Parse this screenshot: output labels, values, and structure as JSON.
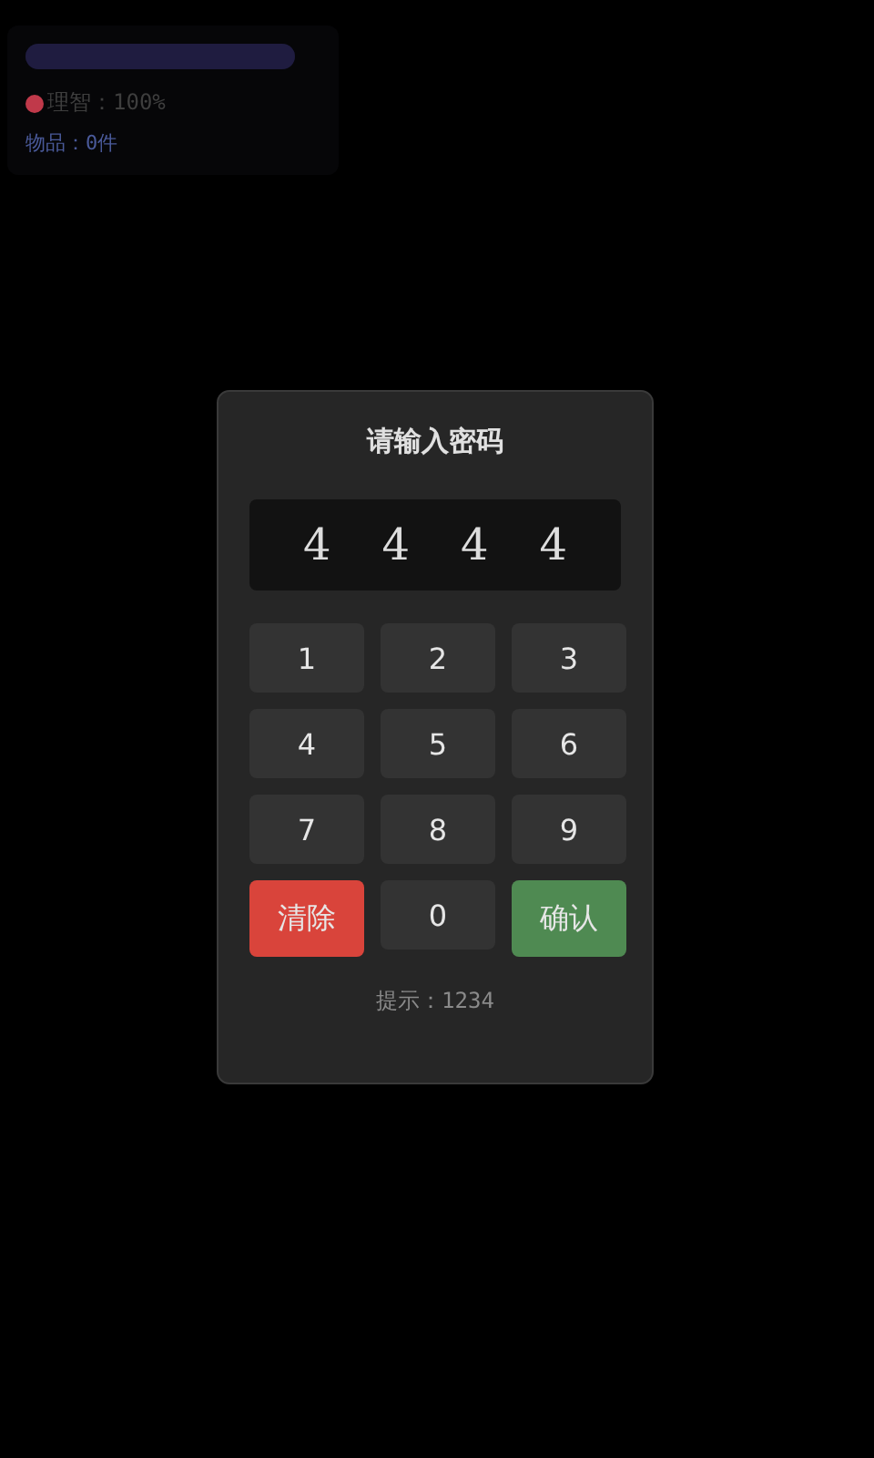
{
  "status_panel": {
    "bar": {
      "level": 1
    },
    "sanity": {
      "label": "理智：100%",
      "color": "#c0394a"
    },
    "items": "物品：0件"
  },
  "dialog": {
    "title": "请输入密码",
    "digits": [
      "4",
      "4",
      "4",
      "4"
    ],
    "keys": [
      {
        "label": "1",
        "kind": "digit"
      },
      {
        "label": "2",
        "kind": "digit"
      },
      {
        "label": "3",
        "kind": "digit"
      },
      {
        "label": "4",
        "kind": "digit"
      },
      {
        "label": "5",
        "kind": "digit"
      },
      {
        "label": "6",
        "kind": "digit"
      },
      {
        "label": "7",
        "kind": "digit"
      },
      {
        "label": "8",
        "kind": "digit"
      },
      {
        "label": "9",
        "kind": "digit"
      },
      {
        "label": "清除",
        "kind": "clear"
      },
      {
        "label": "0",
        "kind": "digit"
      },
      {
        "label": "确认",
        "kind": "confirm"
      }
    ],
    "hint": "提示：1234"
  }
}
